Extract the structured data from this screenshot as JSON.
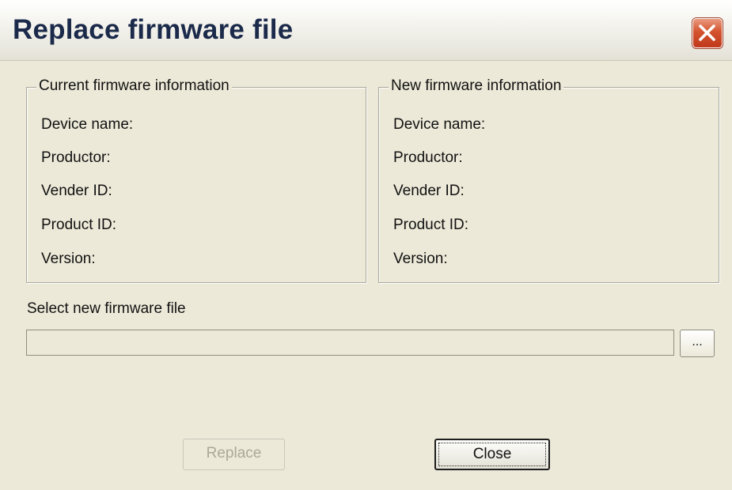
{
  "window": {
    "title": "Replace firmware file"
  },
  "current_group": {
    "legend": "Current firmware information",
    "fields": [
      "Device name:",
      "Productor:",
      "Vender ID:",
      "Product ID:",
      "Version:"
    ]
  },
  "new_group": {
    "legend": "New firmware information",
    "fields": [
      "Device name:",
      "Productor:",
      "Vender ID:",
      "Product ID:",
      "Version:"
    ]
  },
  "file_select": {
    "label": "Select new firmware file",
    "value": "",
    "browse_label": "..."
  },
  "buttons": {
    "replace_label": "Replace",
    "close_label": "Close"
  },
  "colors": {
    "dialog_bg": "#ece9d8",
    "close_red": "#d4532e",
    "disabled_text": "#aca899"
  }
}
